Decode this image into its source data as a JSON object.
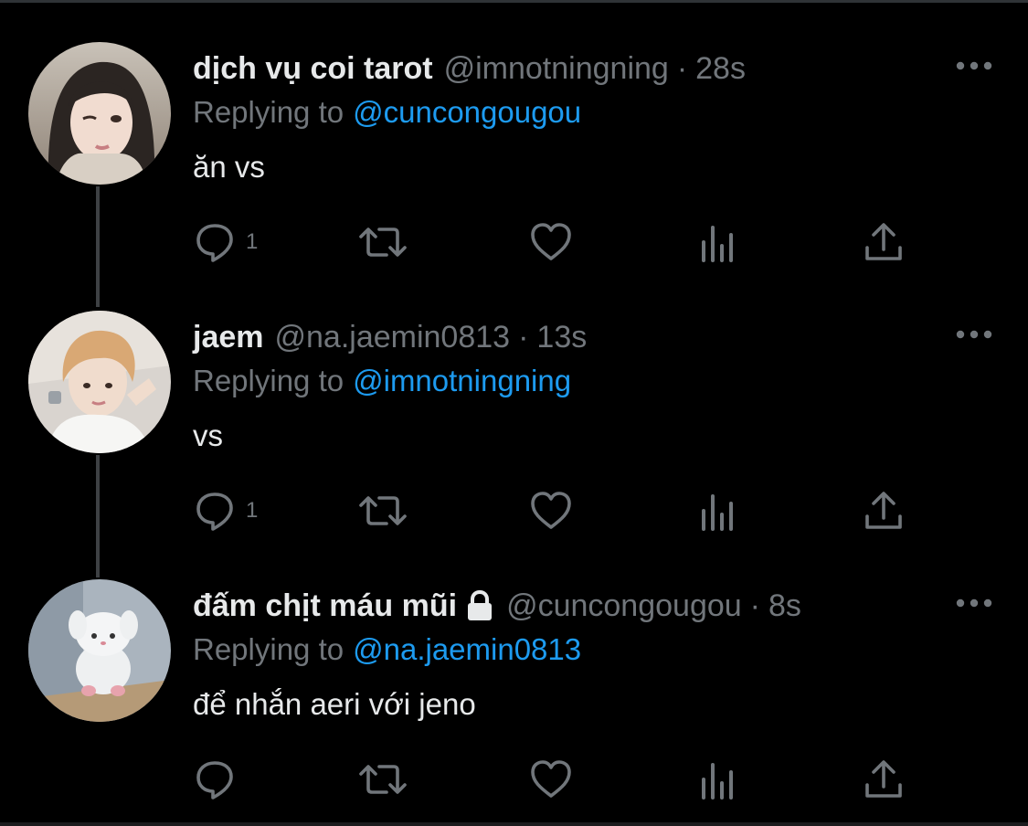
{
  "tweets": [
    {
      "display_name": "dịch vụ coi tarot",
      "handle": "@imnotningning",
      "separator": "·",
      "time": "28s",
      "replying_label": "Replying to",
      "replying_to": "@cuncongougou",
      "text": "ăn vs",
      "reply_count": "1",
      "protected": false
    },
    {
      "display_name": "jaem",
      "handle": "@na.jaemin0813",
      "separator": "·",
      "time": "13s",
      "replying_label": "Replying to",
      "replying_to": "@imnotningning",
      "text": "vs",
      "reply_count": "1",
      "protected": false
    },
    {
      "display_name": "đấm chịt máu mũi",
      "handle": "@cuncongougou",
      "separator": "·",
      "time": "8s",
      "replying_label": "Replying to",
      "replying_to": "@na.jaemin0813",
      "text": "để nhắn aeri với jeno",
      "reply_count": "",
      "protected": true
    }
  ],
  "icons": {
    "reply": "reply-icon",
    "retweet": "retweet-icon",
    "like": "like-icon",
    "views": "views-icon",
    "share": "share-icon",
    "more": "more-icon",
    "lock": "lock-icon"
  },
  "colors": {
    "background": "#000000",
    "text_primary": "#e7e9ea",
    "text_secondary": "#71767b",
    "accent": "#1d9bf0",
    "thread_line": "#3e4144"
  }
}
